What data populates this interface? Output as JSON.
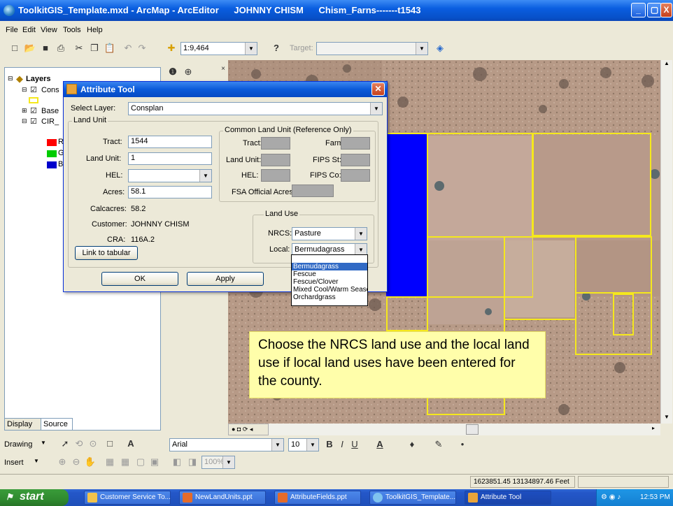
{
  "window": {
    "title": "ToolkitGIS_Template.mxd - ArcMap - ArcEditor      JOHNNY CHISM      Chism_Farns-------t1543",
    "min_label": "_",
    "max_label": "▢",
    "close_label": "X"
  },
  "menu": [
    "File",
    "Edit",
    "View",
    "Tools",
    "Help"
  ],
  "toolbar": {
    "scale": "1:9,464",
    "target_label": "Target:"
  },
  "toc": {
    "root": "Layers",
    "items": [
      "Cons",
      "Base",
      "CIR_"
    ],
    "sub_letters": [
      "R",
      "G",
      "B"
    ],
    "tabs": [
      "Display",
      "Source"
    ]
  },
  "dialog": {
    "title": "Attribute Tool",
    "select_layer_label": "Select Layer:",
    "select_layer_value": "Consplan",
    "land_unit": {
      "group_title": "Land Unit",
      "tract_label": "Tract:",
      "tract_value": "1544",
      "land_unit_label": "Land Unit:",
      "land_unit_value": "1",
      "hel_label": "HEL:",
      "hel_value": "",
      "acres_label": "Acres:",
      "acres_value": "58.1",
      "calcacres_label": "Calcacres:",
      "calcacres_value": "58.2",
      "customer_label": "Customer:",
      "customer_value": "JOHNNY CHISM",
      "cra_label": "CRA:",
      "cra_value": "116A.2",
      "link_button": "Link to tabular"
    },
    "clu": {
      "group_title": "Common Land Unit (Reference Only)",
      "tract_label": "Tract:",
      "farm_label": "Farm:",
      "land_unit_label": "Land Unit:",
      "fips_st_label": "FIPS St:",
      "hel_label": "HEL:",
      "fips_co_label": "FIPS Co:",
      "fsa_acres_label": "FSA Official Acres:"
    },
    "land_use": {
      "group_title": "Land Use",
      "nrcs_label": "NRCS:",
      "nrcs_value": "Pasture",
      "local_label": "Local:",
      "local_value": "Bermudagrass",
      "options": [
        "Bermudagrass",
        "Fescue",
        "Fescue/Clover",
        "Mixed Cool/Warm Seasc",
        "Orchardgrass"
      ]
    },
    "ok_button": "OK",
    "apply_button": "Apply"
  },
  "note": "Choose the NRCS land use and the local land use if local land uses have been entered for the county.",
  "drawbar": {
    "drawing_label": "Drawing",
    "font": "Arial",
    "font_size": "10"
  },
  "insertbar": {
    "insert_label": "Insert",
    "zoom": "100%"
  },
  "status": {
    "coords": "1623851.45  13134897.46 Feet"
  },
  "taskbar": {
    "start": "start",
    "tasks": [
      "Customer Service To...",
      "NewLandUnits.ppt",
      "AttributeFields.ppt",
      "ToolkitGIS_Template...",
      "Attribute Tool"
    ],
    "time": "12:53 PM"
  },
  "colors": {
    "legend_r": "#ff0000",
    "legend_g": "#00cc00",
    "legend_b": "#0000cc",
    "selected_polygon": "#0000ff",
    "field_boundary": "#f5e81c",
    "note_bg": "#fffeaa"
  }
}
